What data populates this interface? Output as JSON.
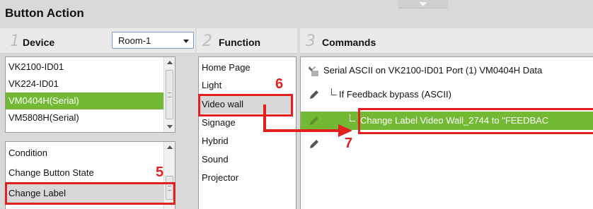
{
  "title": "Button Action",
  "device_panel": {
    "number": "1",
    "label": "Device",
    "room_select": "Room-1",
    "devices": [
      "VK2100-ID01",
      "VK224-ID01",
      "VM0404H(Serial)",
      "VM5808H(Serial)"
    ],
    "selected_device": "VM0404H(Serial)",
    "actions": [
      "Condition",
      "Change Button State",
      "Change Label"
    ],
    "selected_action": "Change Label"
  },
  "function_panel": {
    "number": "2",
    "label": "Function",
    "items": [
      "Home Page",
      "Light",
      "Video wall",
      "Signage",
      "Hybrid",
      "Sound",
      "Projector"
    ],
    "selected_item": "Video wall"
  },
  "commands_panel": {
    "number": "3",
    "label": "Commands",
    "rows": [
      "Serial ASCII on VK2100-ID01 Port (1) VM0404H Data",
      "If Feedback bypass (ASCII)",
      "Change Label Video Wall_2744 to \"FEEDBAC"
    ],
    "selected_row": "Change Label Video Wall_2744 to \"FEEDBAC"
  },
  "callouts": [
    "5",
    "6",
    "7"
  ],
  "colors": {
    "selection_green": "#73b933",
    "callout_red": "#e32020",
    "background": "#d9d9d9"
  },
  "icons": [
    "hand-serial-icon",
    "pencil-icon",
    "pencil-icon",
    "pencil-icon"
  ]
}
